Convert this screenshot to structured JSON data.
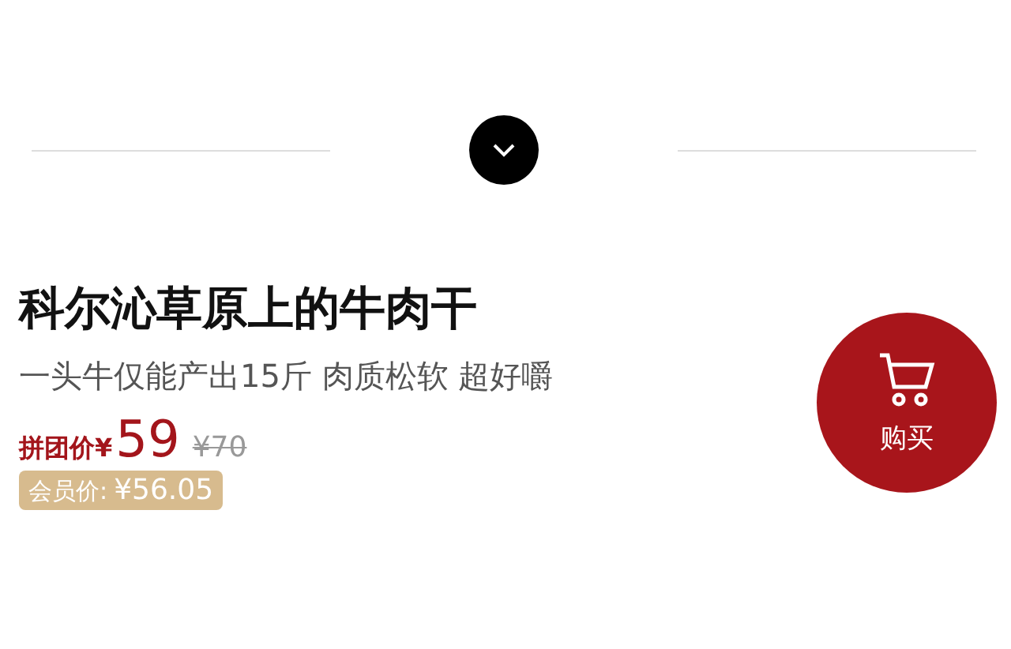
{
  "title": "科尔沁草原上的牛肉干",
  "subtitle": "一头牛仅能产出15斤 肉质松软 超好嚼",
  "group_price": {
    "label": "拼团价¥",
    "value": "59",
    "original": "¥70"
  },
  "member_price": {
    "label": "会员价:",
    "value": "¥56.05"
  },
  "buy_button": {
    "label": "购买"
  }
}
